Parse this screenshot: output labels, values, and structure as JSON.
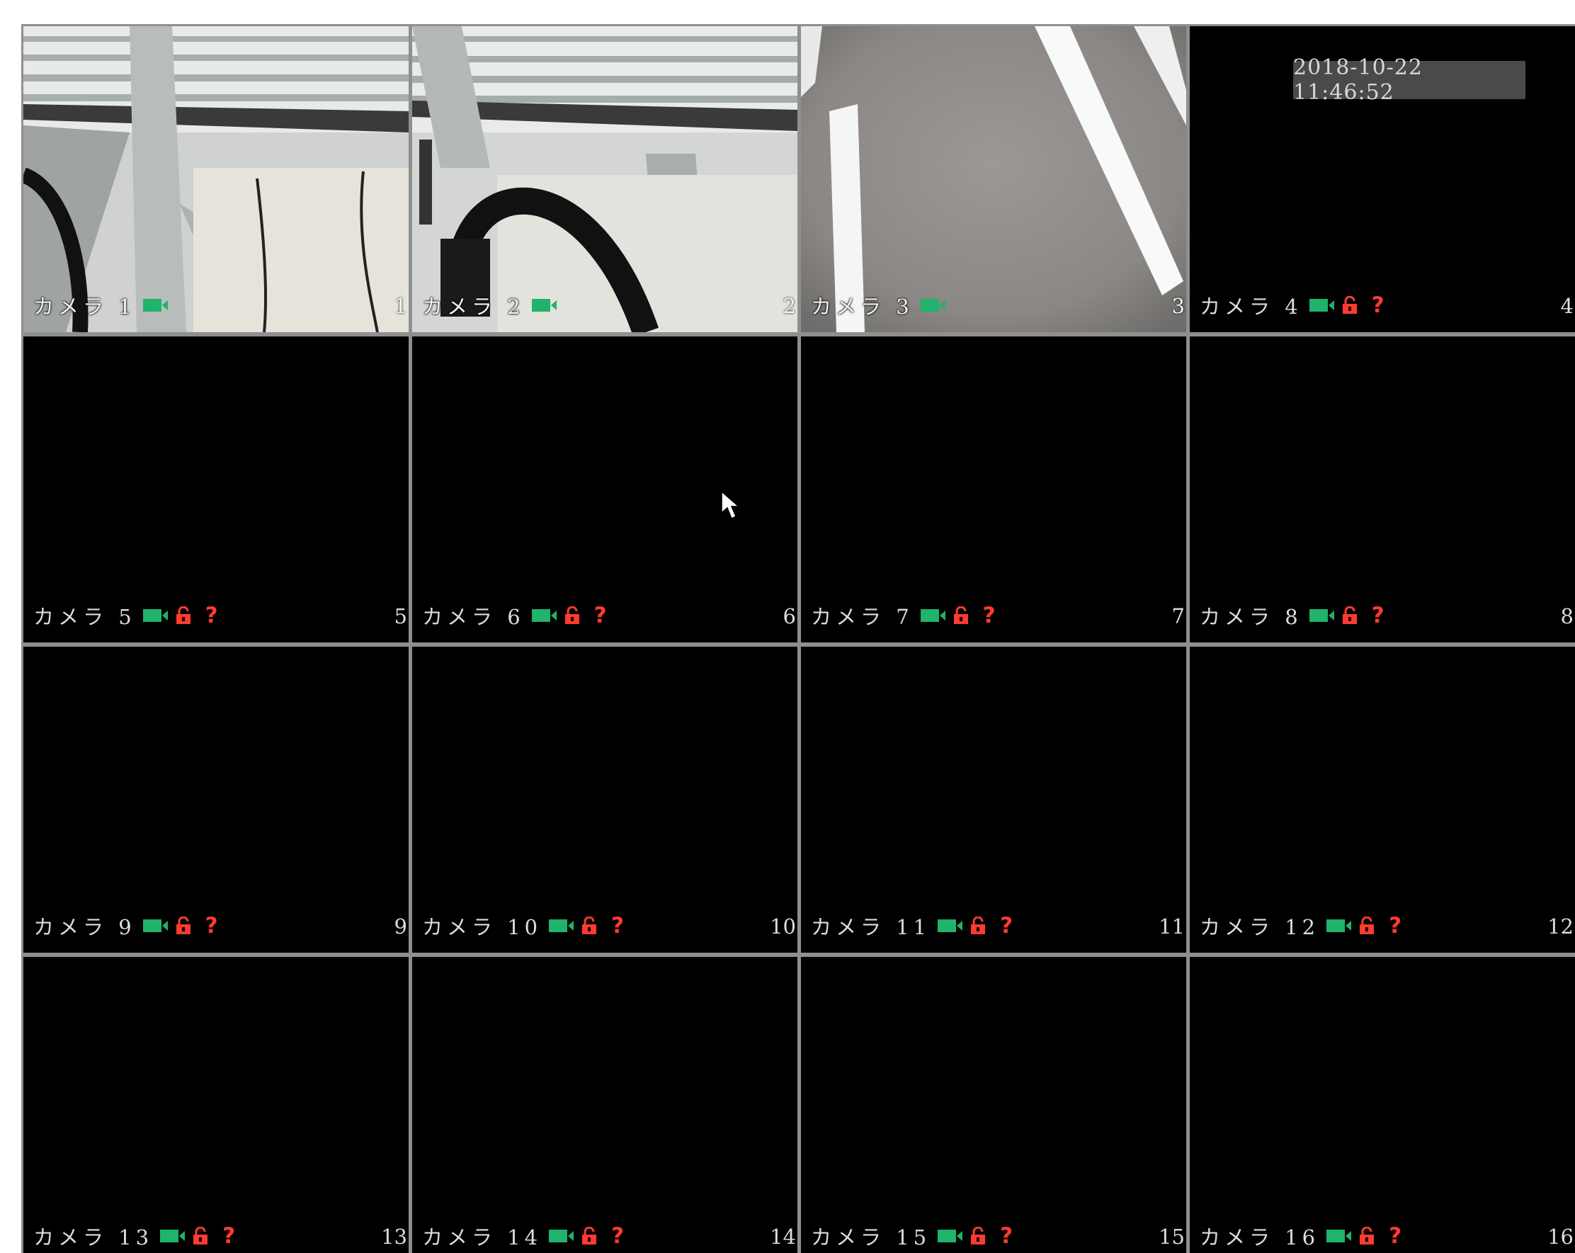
{
  "timestamp": "2018-10-22 11:46:52",
  "colors": {
    "record_icon": "#1fb36b",
    "alert_icon": "#ff3b30",
    "grid_border": "#8f8f8f",
    "tile_bg": "#000000"
  },
  "icons": {
    "record": "video-camera-icon",
    "lock": "lock-icon",
    "unknown": "question-mark-icon",
    "pointer": "mouse-cursor-icon"
  },
  "cameras": [
    {
      "label": "カメラ 1",
      "number": "1",
      "status_question": ""
    },
    {
      "label": "カメラ 2",
      "number": "2",
      "status_question": ""
    },
    {
      "label": "カメラ 3",
      "number": "3",
      "status_question": ""
    },
    {
      "label": "カメラ 4",
      "number": "4",
      "status_question": "?"
    },
    {
      "label": "カメラ 5",
      "number": "5",
      "status_question": "?"
    },
    {
      "label": "カメラ 6",
      "number": "6",
      "status_question": "?"
    },
    {
      "label": "カメラ 7",
      "number": "7",
      "status_question": "?"
    },
    {
      "label": "カメラ 8",
      "number": "8",
      "status_question": "?"
    },
    {
      "label": "カメラ 9",
      "number": "9",
      "status_question": "?"
    },
    {
      "label": "カメラ 10",
      "number": "10",
      "status_question": "?"
    },
    {
      "label": "カメラ 11",
      "number": "11",
      "status_question": "?"
    },
    {
      "label": "カメラ 12",
      "number": "12",
      "status_question": "?"
    },
    {
      "label": "カメラ 13",
      "number": "13",
      "status_question": "?"
    },
    {
      "label": "カメラ 14",
      "number": "14",
      "status_question": "?"
    },
    {
      "label": "カメラ 15",
      "number": "15",
      "status_question": "?"
    },
    {
      "label": "カメラ 16",
      "number": "16",
      "status_question": "?"
    }
  ]
}
